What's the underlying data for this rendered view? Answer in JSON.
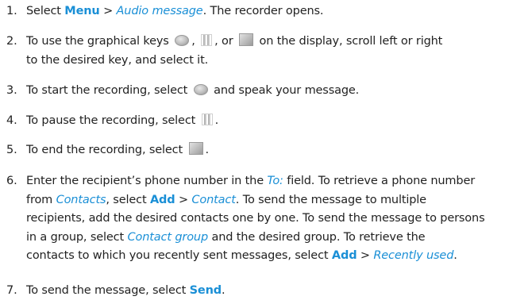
{
  "steps": [
    {
      "num": "1.",
      "a": "Select ",
      "menu": "Menu",
      "sep": " > ",
      "link": "Audio message",
      "b": ". The recorder opens."
    },
    {
      "num": "2.",
      "a": "To use the graphical keys",
      "b": ",",
      "c": ", or",
      "d": "on the display, scroll left or right",
      "line2": "to the desired key, and select it."
    },
    {
      "num": "3.",
      "a": "To start the recording, select",
      "b": "and speak your message."
    },
    {
      "num": "4.",
      "a": "To pause the recording, select",
      "b": "."
    },
    {
      "num": "5.",
      "a": "To end the recording, select",
      "b": "."
    },
    {
      "num": "6.",
      "l1a": "Enter the recipient’s phone number in the ",
      "l1link": "To:",
      "l1b": " field. To retrieve a phone number",
      "l2a": "from ",
      "l2link": "Contacts",
      "l2b": ", select ",
      "l2menu": "Add",
      "l2sep": " > ",
      "l2link2": "Contact",
      "l2c": ". To send the message to multiple",
      "l3": "recipients, add the desired contacts one by one. To send the message to persons",
      "l4a": "in a group, select ",
      "l4link": "Contact group",
      "l4b": " and the desired group. To retrieve the",
      "l5a": "contacts to which you recently sent messages, select ",
      "l5menu": "Add",
      "l5sep": " > ",
      "l5link": "Recently used",
      "l5b": "."
    },
    {
      "num": "7.",
      "a": "To send the message, select ",
      "menu": "Send",
      "b": "."
    }
  ],
  "icons": {
    "record": "record-key-icon",
    "pause": "pause-key-icon",
    "stop": "stop-key-icon"
  },
  "colors": {
    "text": "#222222",
    "link": "#1a8fd6"
  }
}
